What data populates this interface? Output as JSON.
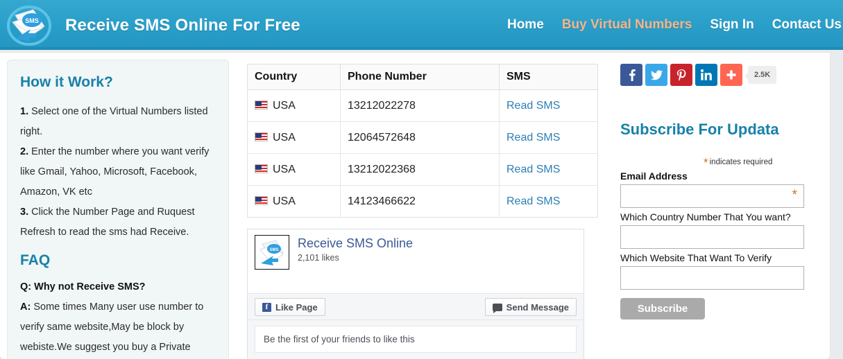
{
  "header": {
    "logo_icon": "sms-envelope-logo",
    "title": "Receive SMS Online For Free",
    "nav": [
      {
        "label": "Home",
        "accent": false
      },
      {
        "label": "Buy Virtual Numbers",
        "accent": true
      },
      {
        "label": "Sign In",
        "accent": false
      },
      {
        "label": "Contact Us",
        "accent": false
      }
    ]
  },
  "sidebar": {
    "how_title": "How it Work?",
    "steps": [
      {
        "num": "1.",
        "text": " Select one of the Virtual Numbers listed right."
      },
      {
        "num": "2.",
        "text": " Enter the number where you want verify like Gmail, Yahoo, Microsoft, Facebook, Amazon, VK etc"
      },
      {
        "num": "3.",
        "text": " Click the Number Page and Ruquest Refresh to read the sms had Receive."
      }
    ],
    "faq_title": "FAQ",
    "faq_question": "Q: Why not Receive SMS?",
    "faq_answer_prefix": "A:",
    "faq_answer": " Some times Many user use number to verify same website,May be block by webiste.We suggest you buy a Private"
  },
  "table": {
    "headers": [
      "Country",
      "Phone Number",
      "SMS"
    ],
    "rows": [
      {
        "country": "USA",
        "flag": "us-flag-icon",
        "number": "13212022278",
        "action": "Read SMS"
      },
      {
        "country": "USA",
        "flag": "us-flag-icon",
        "number": "12064572648",
        "action": "Read SMS"
      },
      {
        "country": "USA",
        "flag": "us-flag-icon",
        "number": "13212022368",
        "action": "Read SMS"
      },
      {
        "country": "USA",
        "flag": "us-flag-icon",
        "number": "14123466622",
        "action": "Read SMS"
      }
    ]
  },
  "facebook_widget": {
    "page_name": "Receive SMS Online",
    "likes": "2,101 likes",
    "like_button": "Like Page",
    "message_button": "Send Message",
    "friends_text": "Be the first of your friends to like this",
    "avatar_icon": "sms-envelope-logo"
  },
  "social": {
    "buttons": [
      {
        "name": "facebook",
        "icon": "facebook-icon",
        "color": "#3b5998"
      },
      {
        "name": "twitter",
        "icon": "twitter-icon",
        "color": "#38a8e8"
      },
      {
        "name": "pinterest",
        "icon": "pinterest-icon",
        "color": "#c8232c"
      },
      {
        "name": "linkedin",
        "icon": "linkedin-icon",
        "color": "#0077b5"
      },
      {
        "name": "addthis",
        "icon": "plus-icon",
        "color": "#ff6550"
      }
    ],
    "count": "2.5K"
  },
  "subscribe": {
    "title": "Subscribe For Updata",
    "required_note": "indicates required",
    "required_star": "*",
    "email_label": "Email Address",
    "email_value": "",
    "country_label": "Which Country Number That You want?",
    "country_value": "",
    "website_label": "Which Website That Want To Verify",
    "website_value": "",
    "button_label": "Subscribe"
  },
  "colors": {
    "header_blue": "#2ba0ca",
    "header_border": "#1f8cb4",
    "accent_orange": "#f7b488",
    "heading_teal": "#1781a8",
    "link_blue": "#2a7fb5",
    "required_orange": "#d4701a",
    "subscribe_gray": "#aaaaaa"
  }
}
